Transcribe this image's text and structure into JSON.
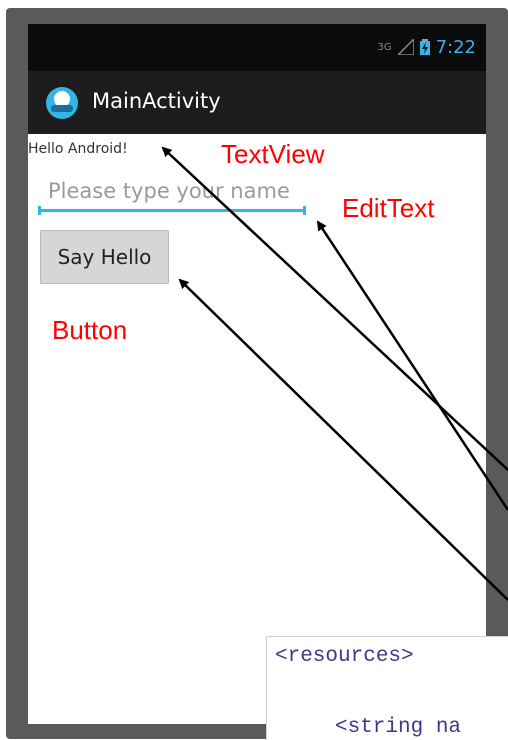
{
  "status_bar": {
    "network": "3G",
    "time": "7:22"
  },
  "action_bar": {
    "title": "MainActivity"
  },
  "content": {
    "hello_text": "Hello Android!",
    "name_input": {
      "value": "",
      "placeholder": "Please type your name"
    },
    "say_hello_button": "Say Hello"
  },
  "annotations": {
    "textview": "TextView",
    "edittext": "EditText",
    "button": "Button"
  },
  "code_snippet": {
    "line1": "<resources>",
    "line2": "<string na"
  },
  "colors": {
    "accent": "#33b5e5",
    "annotation": "#ff0000",
    "action_bar": "#1d1d1d",
    "status_bar": "#0b0b0b"
  },
  "icons": [
    "signal-icon",
    "battery-icon",
    "app-icon"
  ]
}
